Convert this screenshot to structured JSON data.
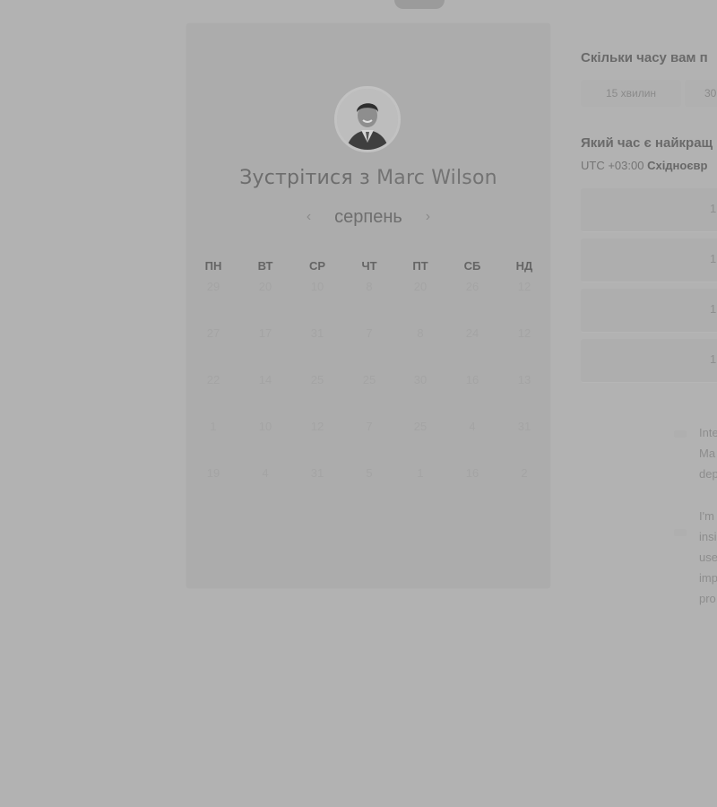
{
  "scheduler": {
    "title_prefix": "Зустрітися з",
    "host_name": "Marc Wilson",
    "month": "серпень",
    "prev_icon": "‹",
    "next_icon": "›"
  },
  "calendar": {
    "weekdays": [
      "ПН",
      "ВТ",
      "СР",
      "ЧТ",
      "ПТ",
      "СБ",
      "НД"
    ],
    "weeks": [
      [
        "29",
        "20",
        "10",
        "8",
        "20",
        "26",
        "12"
      ],
      [
        "27",
        "17",
        "31",
        "7",
        "8",
        "24",
        "12"
      ],
      [
        "22",
        "14",
        "25",
        "25",
        "30",
        "16",
        "13"
      ],
      [
        "1",
        "10",
        "12",
        "7",
        "25",
        "4",
        "31"
      ],
      [
        "19",
        "4",
        "31",
        "5",
        "1",
        "16",
        "2"
      ]
    ]
  },
  "side_panel": {
    "duration_question": "Скільки часу вам п",
    "durations": [
      "15 хвилин",
      "30"
    ],
    "time_question": "Який час є найкращ",
    "timezone_offset": "UTC +03:00",
    "timezone_name": "Східноєвр",
    "time_slots": [
      "1",
      "1",
      "1",
      "1"
    ],
    "description_1": [
      "Inte",
      "Ma",
      "dep"
    ],
    "description_2": [
      "I'm",
      "insi",
      "use",
      "imp",
      "pro"
    ]
  }
}
